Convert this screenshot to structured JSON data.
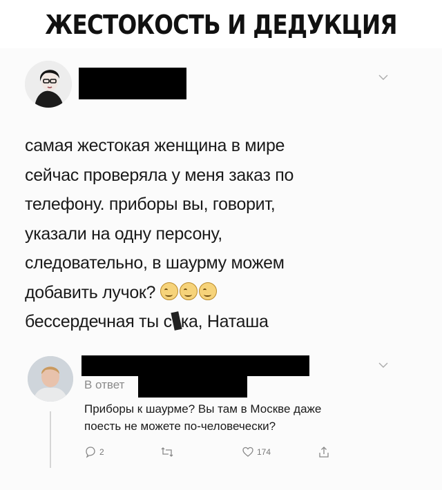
{
  "header": {
    "title": "ЖЕСТОКОСТЬ И ДЕДУКЦИЯ"
  },
  "tweet": {
    "lines": [
      "самая жестокая женщина в мире",
      "сейчас проверяла у меня заказ по",
      "телефону. приборы вы, говорит,",
      "указали на одну персону,",
      "следовательно, в шаурму можем",
      "добавить лучок?",
      "бессердечная ты с",
      "ка, Наташа"
    ],
    "emoji_count": 3,
    "icons": {
      "chevron": "chevron-down-icon",
      "emoji": "winking-face-icon"
    }
  },
  "reply": {
    "reply_to_label": "В ответ",
    "text_lines": [
      "Приборы к шаурме? Вы там в Москве даже",
      "поесть не можете по-человечески?"
    ],
    "actions": {
      "reply_count": "2",
      "retweet_count": "",
      "like_count": "174"
    }
  },
  "colors": {
    "redaction": "#000000",
    "muted": "#8a8a8a",
    "text": "#1a1a1a"
  }
}
